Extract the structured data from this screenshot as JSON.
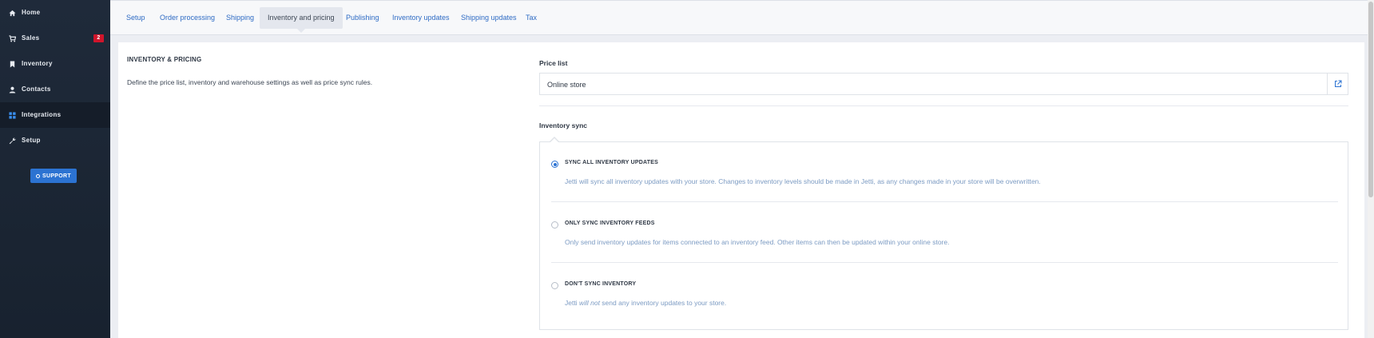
{
  "sidebar": {
    "items": [
      {
        "label": "Home",
        "icon": "home-icon"
      },
      {
        "label": "Sales",
        "icon": "cart-icon",
        "badge": "2"
      },
      {
        "label": "Inventory",
        "icon": "bookmark-icon"
      },
      {
        "label": "Contacts",
        "icon": "person-icon"
      },
      {
        "label": "Integrations",
        "icon": "grid-icon",
        "active": true
      },
      {
        "label": "Setup",
        "icon": "wrench-icon"
      }
    ],
    "support_label": "SUPPORT"
  },
  "tabs": [
    {
      "label": "Setup"
    },
    {
      "label": "Order processing"
    },
    {
      "label": "Shipping"
    },
    {
      "label": "Inventory and pricing",
      "active": true
    },
    {
      "label": "Publishing"
    },
    {
      "label": "Inventory updates"
    },
    {
      "label": "Shipping updates"
    },
    {
      "label": "Tax"
    }
  ],
  "section": {
    "title": "INVENTORY & PRICING",
    "description": "Define the price list, inventory and warehouse settings as well as price sync rules."
  },
  "price_list": {
    "label": "Price list",
    "value": "Online store"
  },
  "inventory_sync": {
    "label": "Inventory sync",
    "options": [
      {
        "title": "SYNC ALL INVENTORY UPDATES",
        "description": "Jetti will sync all inventory updates with your store. Changes to inventory levels should be made in Jetti, as any changes made in your store will be overwritten.",
        "checked": true
      },
      {
        "title": "ONLY SYNC INVENTORY FEEDS",
        "description": "Only send inventory updates for items connected to an inventory feed. Other items can then be updated within your online store.",
        "checked": false
      },
      {
        "title": "DON'T SYNC INVENTORY",
        "description_prefix": "Jetti ",
        "description_em": "will not",
        "description_suffix": " send any inventory updates to your store.",
        "checked": false
      }
    ]
  },
  "colors": {
    "sidebar_bg": "#1f2a3a",
    "accent": "#2c73d2",
    "badge": "#d0152b",
    "link": "#2e6bc4"
  }
}
